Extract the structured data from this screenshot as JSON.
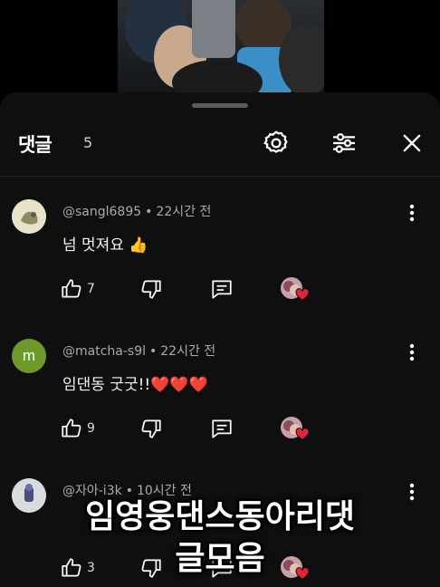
{
  "header": {
    "title": "댓글",
    "count": "5"
  },
  "comments": [
    {
      "handle": "@sangl6895",
      "sep": "•",
      "time": "22시간 전",
      "text": "넘 멋져요 👍",
      "likes": "7",
      "avatar_color": "#e8e2c8",
      "avatar_letter": ""
    },
    {
      "handle": "@matcha-s9l",
      "sep": "•",
      "time": "22시간 전",
      "text": "임댄동 굿굿!!❤️❤️❤️",
      "likes": "9",
      "avatar_color": "#6f9a2b",
      "avatar_letter": "m"
    },
    {
      "handle": "@자아-i3k",
      "sep": "•",
      "time": "10시간 전",
      "text": "",
      "likes": "3",
      "avatar_color": "#d9dbe0",
      "avatar_letter": ""
    }
  ],
  "overlay": {
    "line1": "임영웅댄스동아리댓",
    "line2": "글모음"
  },
  "icons": [
    "settings-icon",
    "filter-icon",
    "close-icon",
    "more-vert-icon",
    "like-icon",
    "dislike-icon",
    "reply-icon",
    "creator-heart-icon"
  ],
  "colors": {
    "panel": "#0f0f0f",
    "meta": "#aaaaaa",
    "heart": "#e0253a"
  }
}
